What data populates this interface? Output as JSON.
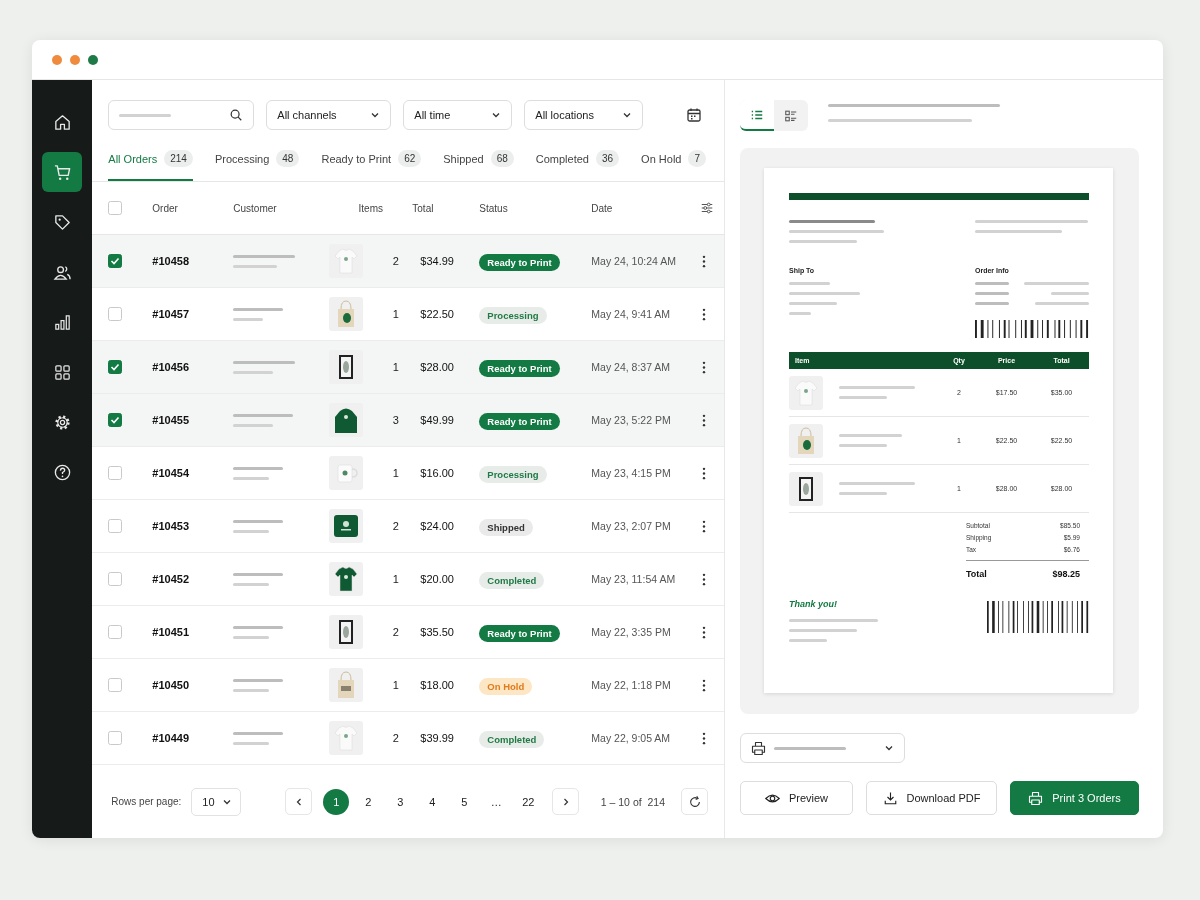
{
  "window": {
    "traffic_lights": [
      {
        "color": "#f08a3c"
      },
      {
        "color": "#f08a3c"
      },
      {
        "color": "#1e7a46"
      }
    ]
  },
  "sidebar": {
    "items": [
      {
        "selected": false
      },
      {
        "selected": true
      },
      {
        "selected": false
      },
      {
        "selected": false
      },
      {
        "selected": false
      },
      {
        "selected": false
      },
      {
        "selected": false
      },
      {
        "selected": false
      }
    ]
  },
  "filters": {
    "dropdowns": [
      "All channels",
      "All time",
      "All locations"
    ]
  },
  "tabs": [
    {
      "label": "All Orders",
      "count": "214",
      "selected": true
    },
    {
      "label": "Processing",
      "count": "48",
      "selected": false
    },
    {
      "label": "Ready to Print",
      "count": "62",
      "selected": false
    },
    {
      "label": "Shipped",
      "count": "68",
      "selected": false
    },
    {
      "label": "Completed",
      "count": "36",
      "selected": false
    },
    {
      "label": "On Hold",
      "count": "7",
      "selected": false
    }
  ],
  "table": {
    "header_checked": false,
    "columns": [
      "Order",
      "Customer",
      "Items",
      "Total",
      "Status",
      "Date"
    ],
    "rows": [
      {
        "checked": true,
        "order": "#10458",
        "qty": "2",
        "total": "$34.99",
        "status": "Ready to Print",
        "kind": "ready",
        "date": "May 24, 10:24 AM"
      },
      {
        "checked": false,
        "order": "#10457",
        "qty": "1",
        "total": "$22.50",
        "status": "Processing",
        "kind": "processing",
        "date": "May 24, 9:41 AM"
      },
      {
        "checked": true,
        "order": "#10456",
        "qty": "1",
        "total": "$28.00",
        "status": "Ready to Print",
        "kind": "ready",
        "date": "May 24, 8:37 AM"
      },
      {
        "checked": true,
        "order": "#10455",
        "qty": "3",
        "total": "$49.99",
        "status": "Ready to Print",
        "kind": "ready",
        "date": "May 23, 5:22 PM"
      },
      {
        "checked": false,
        "order": "#10454",
        "qty": "1",
        "total": "$16.00",
        "status": "Processing",
        "kind": "processing",
        "date": "May 23, 4:15 PM"
      },
      {
        "checked": false,
        "order": "#10453",
        "qty": "2",
        "total": "$24.00",
        "status": "Shipped",
        "kind": "shipped",
        "date": "May 23, 2:07 PM"
      },
      {
        "checked": false,
        "order": "#10452",
        "qty": "1",
        "total": "$20.00",
        "status": "Completed",
        "kind": "completed",
        "date": "May 23, 11:54 AM"
      },
      {
        "checked": false,
        "order": "#10451",
        "qty": "2",
        "total": "$35.50",
        "status": "Ready to Print",
        "kind": "ready",
        "date": "May 22, 3:35 PM"
      },
      {
        "checked": false,
        "order": "#10450",
        "qty": "1",
        "total": "$18.00",
        "status": "On Hold",
        "kind": "hold",
        "date": "May 22, 1:18 PM"
      },
      {
        "checked": false,
        "order": "#10449",
        "qty": "2",
        "total": "$39.99",
        "status": "Completed",
        "kind": "completed",
        "date": "May 22, 9:05 AM"
      }
    ]
  },
  "footer": {
    "rows_per_page_label": "Rows per page:",
    "rows_per_page": "10",
    "pages": [
      {
        "label": "1",
        "selected": true
      },
      {
        "label": "2",
        "selected": false
      },
      {
        "label": "3",
        "selected": false
      },
      {
        "label": "4",
        "selected": false
      },
      {
        "label": "5",
        "selected": false
      },
      {
        "label": "…",
        "selected": false
      },
      {
        "label": "22",
        "selected": false
      }
    ],
    "range": "1 – 10 of  214"
  },
  "preview": {
    "views": [
      {
        "selected": true
      },
      {
        "selected": false
      }
    ],
    "invoice": {
      "ship_to": "Ship To",
      "order_info": "Order Info",
      "columns": [
        "Item",
        "Qty",
        "Price",
        "Total"
      ],
      "items": [
        {
          "qty": "2",
          "price": "$17.50",
          "total": "$35.00"
        },
        {
          "qty": "1",
          "price": "$22.50",
          "total": "$22.50"
        },
        {
          "qty": "1",
          "price": "$28.00",
          "total": "$28.00"
        }
      ],
      "summary": [
        {
          "label": "Subtotal",
          "value": "$85.50"
        },
        {
          "label": "Shipping",
          "value": "$5.99"
        },
        {
          "label": "Tax",
          "value": "$6.76"
        }
      ],
      "total_label": "Total",
      "total": "$98.25",
      "thanks": "Thank you!"
    }
  },
  "actions": [
    {
      "label": "Preview",
      "kind": "preview"
    },
    {
      "label": "Download PDF",
      "kind": "download"
    },
    {
      "label": "Print 3 Orders",
      "kind": "print"
    }
  ]
}
